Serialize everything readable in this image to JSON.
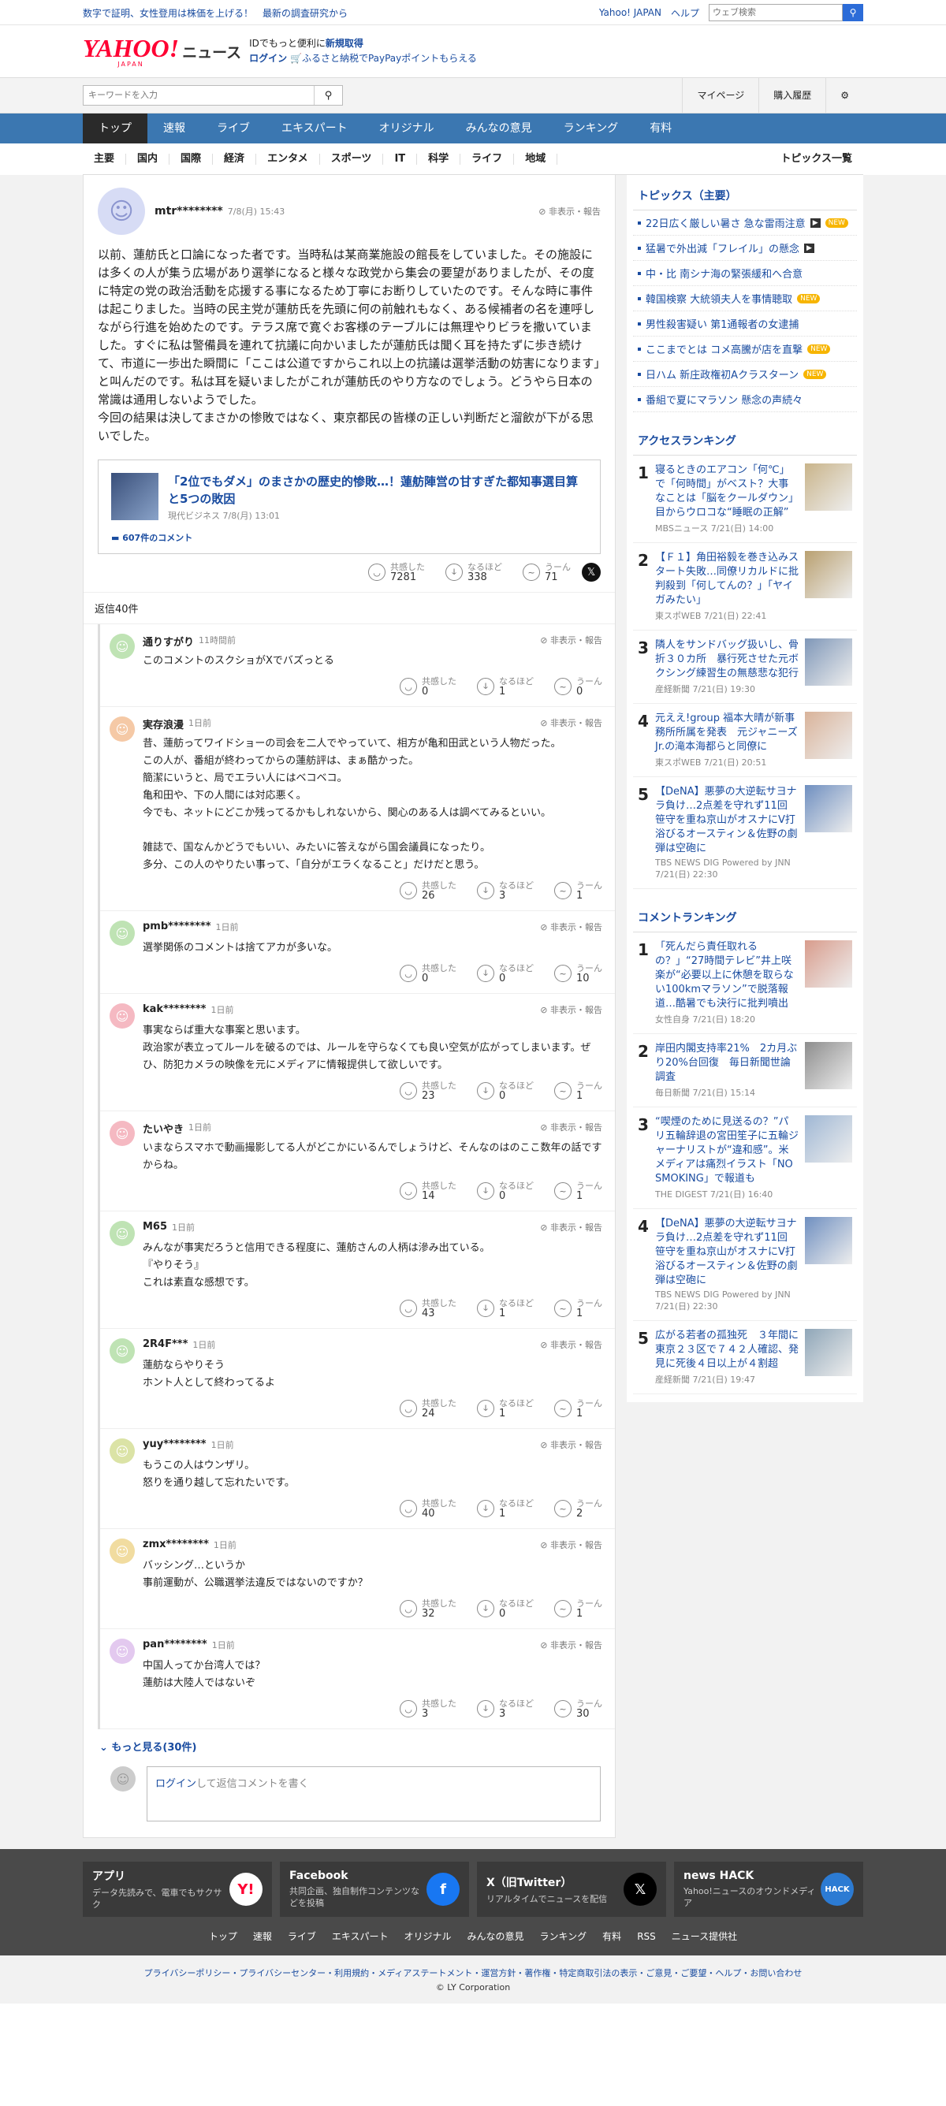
{
  "topbar": {
    "left": "数字で証明、女性登用は株価を上げる！　最新の調査研究から",
    "yahoo": "Yahoo! JAPAN",
    "help": "ヘルプ",
    "search_placeholder": "ウェブ検索"
  },
  "logo": {
    "main": "YAHOO!",
    "sub": "JAPAN",
    "news": "ニュース"
  },
  "promo": {
    "line1a": "IDでもっと便利に",
    "line1b": "新規取得",
    "line2a": "ログイン",
    "line2b": "ふるさと納税でPayPayポイントもらえる"
  },
  "search": {
    "placeholder": "キーワードを入力",
    "mypage": "マイページ",
    "history": "購入履歴"
  },
  "gnav": [
    "トップ",
    "速報",
    "ライブ",
    "エキスパート",
    "オリジナル",
    "みんなの意見",
    "ランキング",
    "有料"
  ],
  "snav": [
    "主要",
    "国内",
    "国際",
    "経済",
    "エンタメ",
    "スポーツ",
    "IT",
    "科学",
    "ライフ",
    "地域",
    "トピックス一覧"
  ],
  "main_comment": {
    "user": "mtr********",
    "date": "7/8(月) 15:43",
    "report": "非表示・報告",
    "text": "以前、蓮舫氏と口論になった者です。当時私は某商業施設の館長をしていました。その施設には多くの人が集う広場があり選挙になると様々な政党から集会の要望がありましたが、その度に特定の党の政治活動を応援する事になるため丁寧にお断りしていたのです。そんな時に事件は起こりました。当時の民主党が蓮舫氏を先頭に何の前触れもなく、ある候補者の名を連呼しながら行進を始めたのです。テラス席で寛ぐお客様のテーブルには無理やりビラを撒いていました。すぐに私は警備員を連れて抗議に向かいましたが蓮舫氏は聞く耳を持たずに歩き続けて、市道に一歩出た瞬間に「ここは公道ですからこれ以上の抗議は選挙活動の妨害になります」と叫んだのです。私は耳を疑いましたがこれが蓮舫氏のやり方なのでしょう。どうやら日本の常識は通用しないようでした。\n今回の結果は決してまさかの惨敗ではなく、東京都民の皆様の正しい判断だと溜飲が下がる思いでした。",
    "card_title": "「2位でもダメ」のまさかの歴史的惨敗…！蓮舫陣営の甘すぎた都知事選目算と5つの敗因",
    "card_meta": "現代ビジネス 7/8(月) 13:01",
    "card_comments": "607件のコメント",
    "r1": "共感した",
    "r1v": "7281",
    "r2": "なるほど",
    "r2v": "338",
    "r3": "うーん",
    "r3v": "71"
  },
  "reply_count": "返信40件",
  "replies": [
    {
      "user": "通りすがり",
      "date": "11時間前",
      "text": "このコメントのスクショがXでバズっとる",
      "v1": "0",
      "v2": "1",
      "v3": "0",
      "c": "#bfe3b4"
    },
    {
      "user": "実存浪漫",
      "date": "1日前",
      "text": "昔、蓮舫ってワイドショーの司会を二人でやっていて、相方が亀和田武という人物だった。\nこの人が、番組が終わってからの蓮舫評は、まぁ酷かった。\n簡潔にいうと、局でエラい人にはベコベコ。\n亀和田や、下の人間には対応悪く。\n今でも、ネットにどこか残ってるかもしれないから、関心のある人は調べてみるといい。\n\n雑誌で、国なんかどうでもいい、みたいに答えながら国会議員になったり。\n多分、この人のやりたい事って、「自分がエラくなること」だけだと思う。",
      "v1": "26",
      "v2": "3",
      "v3": "1",
      "c": "#f5c9a6"
    },
    {
      "user": "pmb********",
      "date": "1日前",
      "text": "選挙関係のコメントは捨てアカが多いな。",
      "v1": "0",
      "v2": "0",
      "v3": "10",
      "c": "#bfe3b4"
    },
    {
      "user": "kak********",
      "date": "1日前",
      "text": "事実ならば重大な事案と思います。\n政治家が表立ってルールを破るのでは、ルールを守らなくても良い空気が広がってしまいます。ぜひ、防犯カメラの映像を元にメディアに情報提供して欲しいです。",
      "v1": "23",
      "v2": "0",
      "v3": "1",
      "c": "#f5b9c2"
    },
    {
      "user": "たいやき",
      "date": "1日前",
      "text": "いまならスマホで動画撮影してる人がどこかにいるんでしょうけど、そんなのはのここ数年の話ですからね。",
      "v1": "14",
      "v2": "0",
      "v3": "1",
      "c": "#f5b9c2"
    },
    {
      "user": "M65",
      "date": "1日前",
      "text": "みんなが事実だろうと信用できる程度に、蓮舫さんの人柄は滲み出ている。\n『やりそう』\nこれは素直な感想です。",
      "v1": "43",
      "v2": "1",
      "v3": "1",
      "c": "#bfe3b4"
    },
    {
      "user": "2R4F***",
      "date": "1日前",
      "text": "蓮舫ならやりそう\nホント人として終わってるよ",
      "v1": "24",
      "v2": "1",
      "v3": "1",
      "c": "#bfe3b4"
    },
    {
      "user": "yuy********",
      "date": "1日前",
      "text": "もうこの人はウンザリ。\n怒りを通り越して忘れたいです。",
      "v1": "40",
      "v2": "1",
      "v3": "2",
      "c": "#dbe3a6"
    },
    {
      "user": "zmx********",
      "date": "1日前",
      "text": "バッシング…というか\n事前運動が、公職選挙法違反ではないのですか？",
      "v1": "32",
      "v2": "0",
      "v3": "1",
      "c": "#f1dca0"
    },
    {
      "user": "pan********",
      "date": "1日前",
      "text": "中国人ってか台湾人では？\n蓮舫は大陸人ではないぞ",
      "v1": "3",
      "v2": "3",
      "v3": "30",
      "c": "#e3c9ef"
    }
  ],
  "reply_labels": {
    "r1": "共感した",
    "r2": "なるほど",
    "r3": "うーん",
    "report": "非表示・報告"
  },
  "more": "もっと見る(30件)",
  "reply_box": {
    "login": "ログイン",
    "text": "して返信コメントを書く"
  },
  "topics": {
    "title": "トピックス（主要）",
    "items": [
      {
        "t": "22日広く厳しい暑さ 急な雷雨注意",
        "v": true,
        "n": true
      },
      {
        "t": "猛暑で外出減「フレイル」の懸念",
        "v": true,
        "n": false
      },
      {
        "t": "中・比 南シナ海の緊張緩和へ合意",
        "v": false,
        "n": false
      },
      {
        "t": "韓国検察 大統領夫人を事情聴取",
        "v": false,
        "n": true
      },
      {
        "t": "男性殺害疑い 第1通報者の女逮捕",
        "v": false,
        "n": false
      },
      {
        "t": "ここまでとは コメ高騰が店を直撃",
        "v": false,
        "n": true
      },
      {
        "t": "日ハム 新庄政権初Aクラスターン",
        "v": false,
        "n": true
      },
      {
        "t": "番組で夏にマラソン 懸念の声続々",
        "v": false,
        "n": false
      }
    ],
    "new_label": "NEW",
    "video_label": "▶"
  },
  "access": {
    "title": "アクセスランキング",
    "items": [
      {
        "n": "1",
        "t": "寝るときのエアコン「何℃」で「何時間」がベスト？大事なことは「脳をクールダウン」　目からウロコな“睡眠の正解”",
        "m": "MBSニュース 7/21(日) 14:00",
        "c": "#c9b48a"
      },
      {
        "n": "2",
        "t": "【Ｆ１】角田裕毅を巻き込みスタート失敗…同僚リカルドに批判殺到「何してんの？」「ヤイガみたい」",
        "m": "東スポWEB 7/21(日) 22:41",
        "c": "#b9a070"
      },
      {
        "n": "3",
        "t": "隣人をサンドバッグ扱いし、骨折３０カ所　暴行死させた元ボクシング練習生の無慈悲な犯行",
        "m": "産経新聞 7/21(日) 19:30",
        "c": "#7f97b8"
      },
      {
        "n": "4",
        "t": "元ええ!group 福本大晴が新事務所所属を発表　元ジャニーズJr.の滝本海都らと同僚に",
        "m": "東スポWEB 7/21(日) 20:51",
        "c": "#d9b39a"
      },
      {
        "n": "5",
        "t": "【DeNA】悪夢の大逆転サヨナラ負け…2点差を守れず11回 笹守を重ね京山がオスナにV打浴びるオースティン＆佐野の劇弾は空砲に",
        "m": "TBS NEWS DIG Powered by JNN 7/21(日) 22:30",
        "c": "#6f8fc0"
      }
    ]
  },
  "comment_rank": {
    "title": "コメントランキング",
    "items": [
      {
        "n": "1",
        "t": "「死んだら責任取れるの？」“27時間テレビ”井上咲楽が“必要以上に休憩を取らない100kmマラソン”で脱落報道…酷暑でも決行に批判噴出",
        "m": "女性自身 7/21(日) 18:20",
        "c": "#d89c8c"
      },
      {
        "n": "2",
        "t": "岸田内閣支持率21%　2カ月ぶり20%台回復　毎日新聞世論調査",
        "m": "毎日新聞 7/21(日) 15:14",
        "c": "#8d8d8d"
      },
      {
        "n": "3",
        "t": "“喫煙のために見送るの？”パリ五輪辞退の宮田笙子に五輪ジャーナリストが“違和感”。米メディアは痛烈イラスト「NO SMOKING」で報道も",
        "m": "THE DIGEST 7/21(日) 16:40",
        "c": "#9fb7d4"
      },
      {
        "n": "4",
        "t": "【DeNA】悪夢の大逆転サヨナラ負け…2点差を守れず11回 笹守を重ね京山がオスナにV打浴びるオースティン＆佐野の劇弾は空砲に",
        "m": "TBS NEWS DIG Powered by JNN 7/21(日) 22:30",
        "c": "#6f8fc0"
      },
      {
        "n": "5",
        "t": "広がる若者の孤独死　３年間に東京２３区で７４２人確認、発見に死後４日以上が４割超",
        "m": "産経新聞 7/21(日) 19:47",
        "c": "#8fa6b8"
      }
    ]
  },
  "footer": {
    "apps": [
      {
        "t": "アプリ",
        "d": "データ先読みで、電車でもサクサク",
        "ic": "Y!",
        "c": "#fff"
      },
      {
        "t": "Facebook",
        "d": "共同企画、独自制作コンテンツなどを投稿",
        "ic": "f",
        "c": "#1877f2"
      },
      {
        "t": "X（旧Twitter）",
        "d": "リアルタイムでニュースを配信",
        "ic": "𝕏",
        "c": "#000"
      },
      {
        "t": "news HACK",
        "d": "Yahoo!ニュースのオウンドメディア",
        "ic": "HACK",
        "c": "#2c7bd3"
      }
    ],
    "links": [
      "トップ",
      "速報",
      "ライブ",
      "エキスパート",
      "オリジナル",
      "みんなの意見",
      "ランキング",
      "有料",
      "RSS",
      "ニュース提供社"
    ],
    "bottom": "プライバシーポリシー・プライバシーセンター・利用規約・メディアステートメント・運営方針・著作権・特定商取引法の表示・ご意見・ご要望・ヘルプ・お問い合わせ",
    "copy": "© LY Corporation"
  }
}
